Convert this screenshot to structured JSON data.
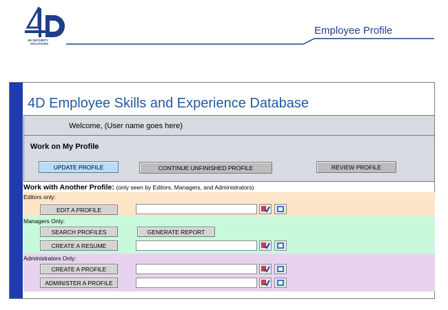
{
  "header": {
    "logo_mark": "4D",
    "logo_caption": "4D SECURITY SOLUTIONS",
    "title": "Employee Profile"
  },
  "main": {
    "title": "4D Employee Skills and Experience Database",
    "welcome": "Welcome, (User name goes here)",
    "my_profile": {
      "heading": "Work on My Profile",
      "update_label": "UPDATE PROFILE",
      "continue_label": "CONTINUE UNFINISHED PROFILE",
      "review_label": "REVIEW PROFILE"
    },
    "another": {
      "heading": "Work with Another Profile:",
      "note": "(only seen by Editors, Managers, and Administrators)"
    },
    "editors": {
      "label": "Editors only:",
      "edit_label": "EDIT A PROFILE",
      "field_value": ""
    },
    "managers": {
      "label": "Managers Only:",
      "search_label": "SEARCH PROFILES",
      "report_label": "GENERATE REPORT",
      "resume_label": "CREATE A RESUME",
      "field_value": ""
    },
    "admins": {
      "label": "Administrators Only:",
      "create_label": "CREATE A PROFILE",
      "administer_label": "ADMINISTER A PROFILE",
      "create_field_value": "",
      "administer_field_value": ""
    }
  },
  "colors": {
    "brand_blue": "#1f3f87",
    "title_blue": "#1f5aa6",
    "left_bar": "#1f3bb0",
    "editors_bg": "#fde6c8",
    "managers_bg": "#c9f9dc",
    "admins_bg": "#e7d3f0",
    "panel_gray": "#d8dbe2"
  },
  "icons": {
    "check": "spellcheck-icon",
    "lookup": "book-icon"
  }
}
